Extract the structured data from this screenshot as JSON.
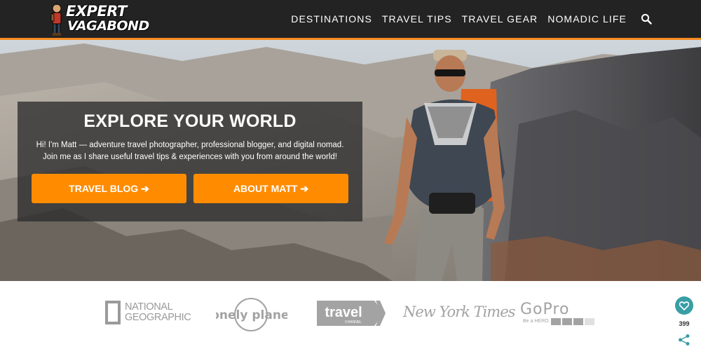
{
  "header": {
    "logo": {
      "line1": "EXPERT",
      "line2": "VAGABOND"
    },
    "nav": [
      {
        "label": "DESTINATIONS"
      },
      {
        "label": "TRAVEL TIPS"
      },
      {
        "label": "TRAVEL GEAR"
      },
      {
        "label": "NOMADIC LIFE"
      }
    ],
    "search_icon": "search-icon"
  },
  "hero": {
    "title": "EXPLORE YOUR WORLD",
    "text": "Hi! I'm Matt — adventure travel photographer, professional blogger, and digital nomad. Join me as I share useful travel tips & experiences with you from around the world!",
    "buttons": [
      {
        "label": "TRAVEL BLOG ➔"
      },
      {
        "label": "ABOUT MATT ➔"
      }
    ]
  },
  "press": {
    "natgeo": {
      "line1": "NATIONAL",
      "line2": "GEOGRAPHIC"
    },
    "lonely_planet": "lonely planet",
    "travel_channel": {
      "word": "travel",
      "sub": "CHANNEL"
    },
    "nyt": "New York Times",
    "gopro": {
      "name": "GoPro",
      "tag": "Be a HERO."
    }
  },
  "share_widget": {
    "count": "399",
    "heart_icon": "heart-icon",
    "share_icon": "share-icon"
  },
  "colors": {
    "header_bg": "#232323",
    "accent": "#ff8c00",
    "share_teal": "#3a9ea5"
  }
}
